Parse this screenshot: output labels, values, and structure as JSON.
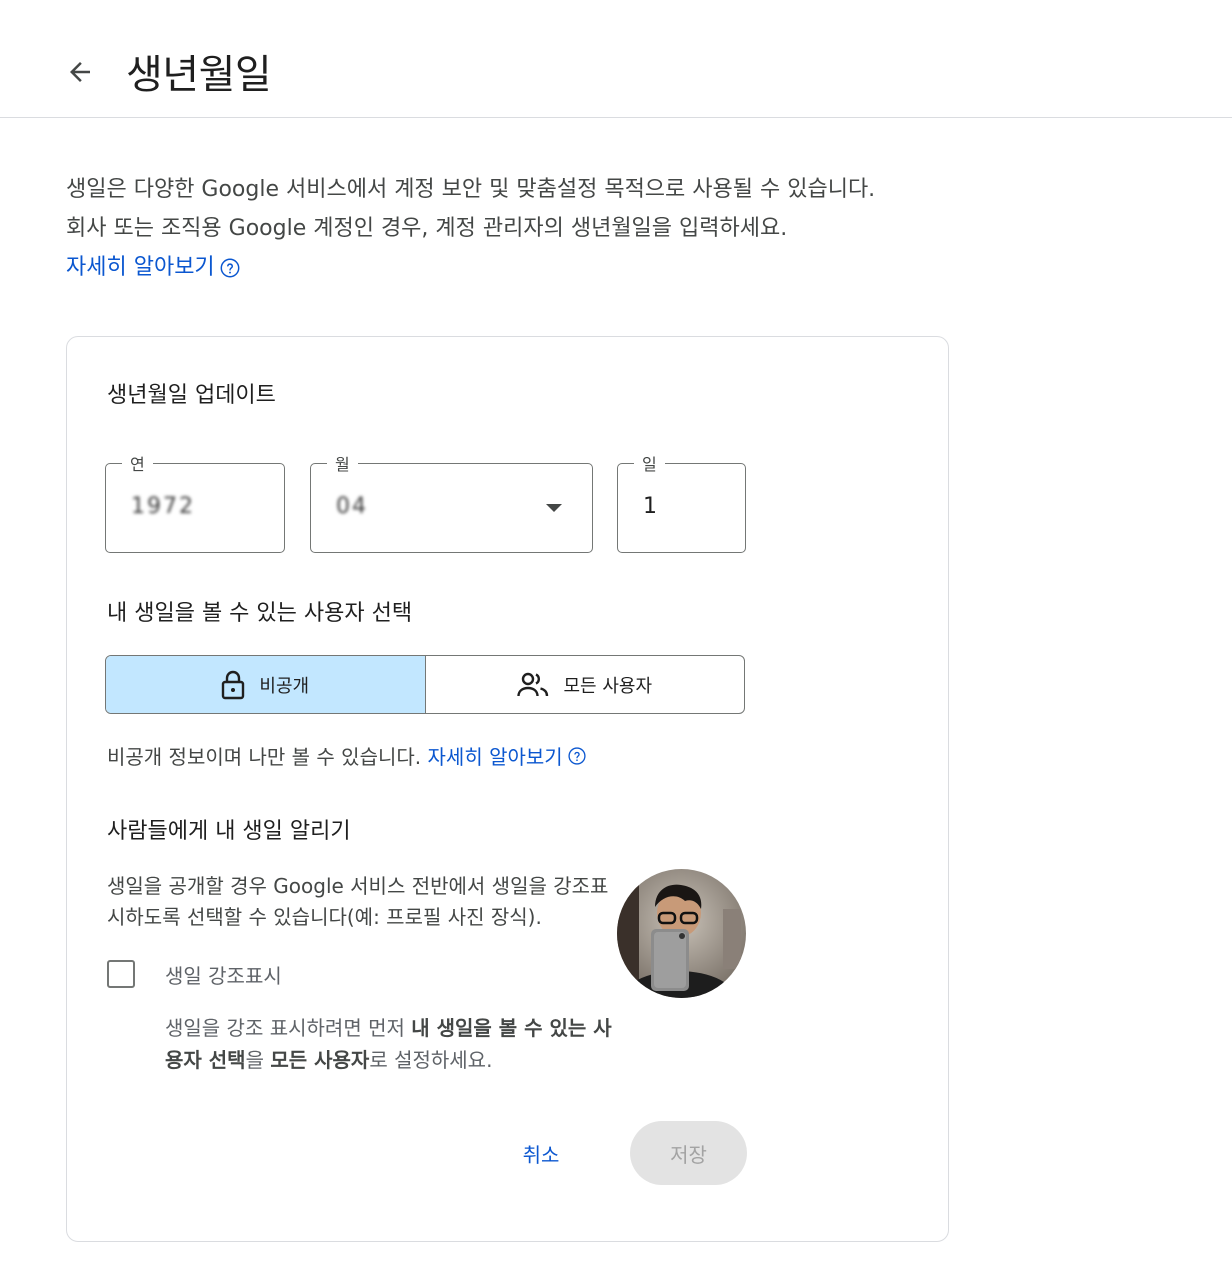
{
  "header": {
    "title": "생년월일"
  },
  "intro": {
    "line1": "생일은 다양한 Google 서비스에서 계정 보안 및 맞춤설정 목적으로 사용될 수 있습니다.",
    "line2": "회사 또는 조직용 Google 계정인 경우, 계정 관리자의 생년월일을 입력하세요.",
    "learn_more": "자세히 알아보기"
  },
  "card": {
    "title": "생년월일 업데이트",
    "year": {
      "label": "연",
      "value": "1972"
    },
    "month": {
      "label": "월",
      "value": "04"
    },
    "day": {
      "label": "일",
      "value": "1"
    },
    "visibility": {
      "title": "내 생일을 볼 수 있는 사용자 선택",
      "options": [
        {
          "label": "비공개",
          "icon": "lock-icon",
          "selected": true
        },
        {
          "label": "모든 사용자",
          "icon": "people-icon",
          "selected": false
        }
      ],
      "helper": "비공개 정보이며 나만 볼 수 있습니다.",
      "learn_more": "자세히 알아보기"
    },
    "notify": {
      "title": "사람들에게 내 생일 알리기",
      "description": "생일을 공개할 경우 Google 서비스 전반에서 생일을 강조표시하도록 선택할 수 있습니다(예: 프로필 사진 장식).",
      "checkbox_label": "생일 강조표시",
      "checked": false,
      "note_1": "생일을 강조 표시하려면 먼저 ",
      "note_bold_1": "내 생일을 볼 수 있는 사용자 선택",
      "note_2": "을 ",
      "note_bold_2": "모든 사용자",
      "note_3": "로 설정하세요."
    },
    "actions": {
      "cancel": "취소",
      "save": "저장"
    }
  },
  "colors": {
    "link": "#0b57d0",
    "selected_bg": "#c2e7ff",
    "border": "#747775",
    "disabled_bg": "#e3e3e3"
  }
}
